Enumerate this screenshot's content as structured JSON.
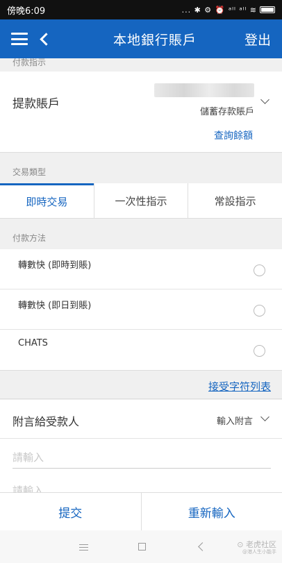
{
  "status_bar": {
    "time": "傍晚6:09",
    "icons": "... ✱ ⚙ ⏰ ᵃˡˡ ᵃˡˡ ≋"
  },
  "header": {
    "title": "本地銀行賬戶",
    "logout_label": "登出"
  },
  "payment_instruction": {
    "section_label": "付款指示",
    "account_label": "提款賬戶",
    "account_type": "儲蓄存款賬戶",
    "balance_link": "查詢餘額"
  },
  "transaction_type": {
    "section_label": "交易類型",
    "tabs": [
      {
        "label": "即時交易",
        "active": true
      },
      {
        "label": "一次性指示",
        "active": false
      },
      {
        "label": "常設指示",
        "active": false
      }
    ]
  },
  "payment_method": {
    "section_label": "付款方法",
    "options": [
      {
        "label": "轉數快 (即時到賬)"
      },
      {
        "label": "轉數快 (即日到賬)"
      },
      {
        "label": "CHATS"
      }
    ]
  },
  "charset_link": "接受字符列表",
  "message": {
    "label": "附言給受款人",
    "value": "輸入附言",
    "placeholder_1": "請輸入",
    "placeholder_2": "請輸入"
  },
  "actions": {
    "submit": "提交",
    "reset": "重新輸入"
  },
  "watermark": {
    "main": "⊙ 老虎社区",
    "sub": "@港人生小能手"
  },
  "colors": {
    "brand": "#1565c0",
    "status_bar": "#111111",
    "background": "#f0f0f0"
  }
}
